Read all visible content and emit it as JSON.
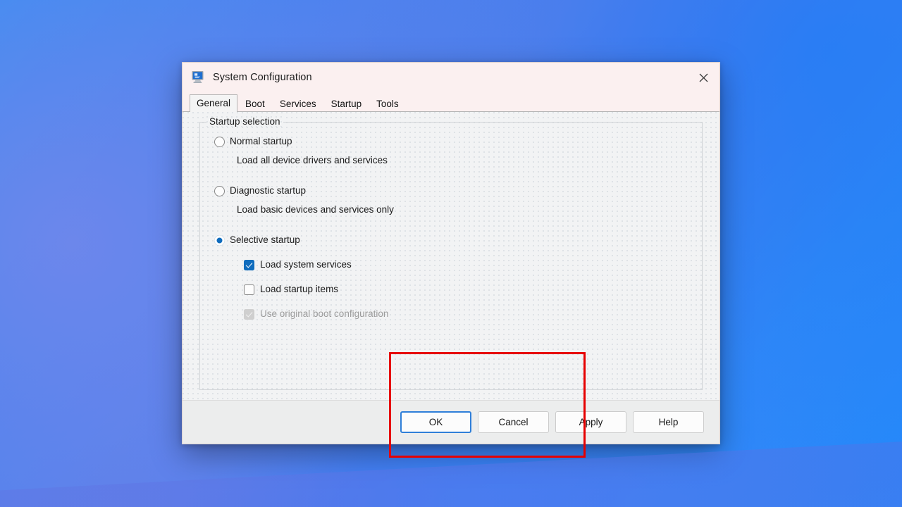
{
  "window": {
    "title": "System Configuration",
    "icon": "system-configuration-icon",
    "close_label": "✕"
  },
  "tabs": [
    {
      "label": "General",
      "active": true
    },
    {
      "label": "Boot",
      "active": false
    },
    {
      "label": "Services",
      "active": false
    },
    {
      "label": "Startup",
      "active": false
    },
    {
      "label": "Tools",
      "active": false
    }
  ],
  "group": {
    "legend": "Startup selection"
  },
  "startup_options": [
    {
      "label": "Normal startup",
      "description": "Load all device drivers and services",
      "selected": false
    },
    {
      "label": "Diagnostic startup",
      "description": "Load basic devices and services only",
      "selected": false
    },
    {
      "label": "Selective startup",
      "description": "",
      "selected": true
    }
  ],
  "selective_checkboxes": [
    {
      "label": "Load system services",
      "checked": true,
      "disabled": false
    },
    {
      "label": "Load startup items",
      "checked": false,
      "disabled": false
    },
    {
      "label": "Use original boot configuration",
      "checked": true,
      "disabled": true
    }
  ],
  "buttons": [
    {
      "label": "OK",
      "focused": true
    },
    {
      "label": "Cancel",
      "focused": false
    },
    {
      "label": "Apply",
      "focused": false
    },
    {
      "label": "Help",
      "focused": false
    }
  ],
  "colors": {
    "accent": "#0f6cbd",
    "highlight": "#e60000",
    "titlebar": "#fbf0f0",
    "focus_ring": "#2f7fd9"
  }
}
